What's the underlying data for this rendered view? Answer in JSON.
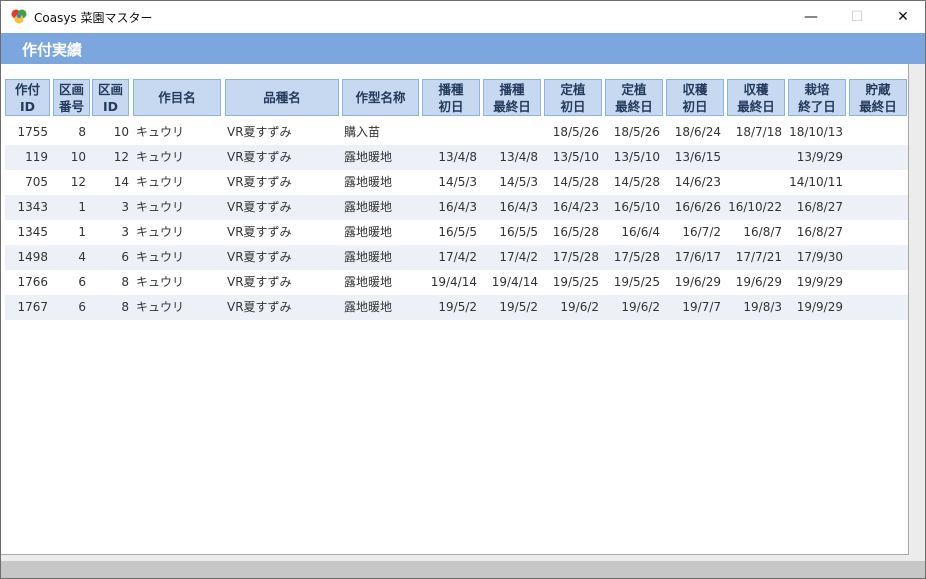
{
  "window": {
    "title": "Coasys 菜園マスター",
    "controls": {
      "minimize": "—",
      "maximize": "☐",
      "close": "✕"
    }
  },
  "section": {
    "title": "作付実績"
  },
  "table": {
    "headers": [
      "作付\nID",
      "区画\n番号",
      "区画\nID",
      "作目名",
      "品種名",
      "作型名称",
      "播種\n初日",
      "播種\n最終日",
      "定植\n初日",
      "定植\n最終日",
      "収穫\n初日",
      "収穫\n最終日",
      "栽培\n終了日",
      "貯蔵\n最終日"
    ],
    "rows": [
      [
        "1755",
        "8",
        "10",
        "キュウリ",
        "VR夏すずみ",
        "購入苗",
        "",
        "",
        "18/5/26",
        "18/5/26",
        "18/6/24",
        "18/7/18",
        "18/10/13",
        ""
      ],
      [
        "119",
        "10",
        "12",
        "キュウリ",
        "VR夏すずみ",
        "露地暖地",
        "13/4/8",
        "13/4/8",
        "13/5/10",
        "13/5/10",
        "13/6/15",
        "",
        "13/9/29",
        ""
      ],
      [
        "705",
        "12",
        "14",
        "キュウリ",
        "VR夏すずみ",
        "露地暖地",
        "14/5/3",
        "14/5/3",
        "14/5/28",
        "14/5/28",
        "14/6/23",
        "",
        "14/10/11",
        ""
      ],
      [
        "1343",
        "1",
        "3",
        "キュウリ",
        "VR夏すずみ",
        "露地暖地",
        "16/4/3",
        "16/4/3",
        "16/4/23",
        "16/5/10",
        "16/6/26",
        "16/10/22",
        "16/8/27",
        ""
      ],
      [
        "1345",
        "1",
        "3",
        "キュウリ",
        "VR夏すずみ",
        "露地暖地",
        "16/5/5",
        "16/5/5",
        "16/5/28",
        "16/6/4",
        "16/7/2",
        "16/8/7",
        "16/8/27",
        ""
      ],
      [
        "1498",
        "4",
        "6",
        "キュウリ",
        "VR夏すずみ",
        "露地暖地",
        "17/4/2",
        "17/4/2",
        "17/5/28",
        "17/5/28",
        "17/6/17",
        "17/7/21",
        "17/9/30",
        ""
      ],
      [
        "1766",
        "6",
        "8",
        "キュウリ",
        "VR夏すずみ",
        "露地暖地",
        "19/4/14",
        "19/4/14",
        "19/5/25",
        "19/5/25",
        "19/6/29",
        "19/6/29",
        "19/9/29",
        ""
      ],
      [
        "1767",
        "6",
        "8",
        "キュウリ",
        "VR夏すずみ",
        "露地暖地",
        "19/5/2",
        "19/5/2",
        "19/6/2",
        "19/6/2",
        "19/7/7",
        "19/8/3",
        "19/9/29",
        ""
      ]
    ]
  },
  "colors": {
    "header_bar": "#7ba7de",
    "column_header_bg": "#c6d9f1",
    "column_header_border": "#8db3e2",
    "alt_row": "#edf1f7"
  }
}
